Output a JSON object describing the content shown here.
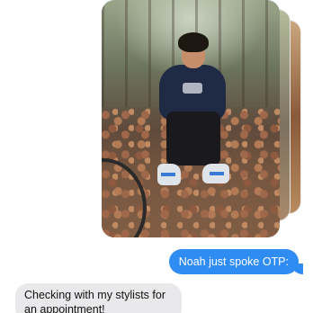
{
  "thread": {
    "photo_message": {
      "image": "photo of a young man sitting on a tree stump in a forest among fallen leaves",
      "stack_count": 3
    },
    "sent_message": {
      "text": "Noah just spoke OTP:"
    },
    "received_message": {
      "text": "Checking with my stylists for an appointment!"
    }
  },
  "colors": {
    "sent_bubble": "#2f8cf3",
    "received_bubble": "#e9e9eb",
    "background": "#ffffff"
  }
}
